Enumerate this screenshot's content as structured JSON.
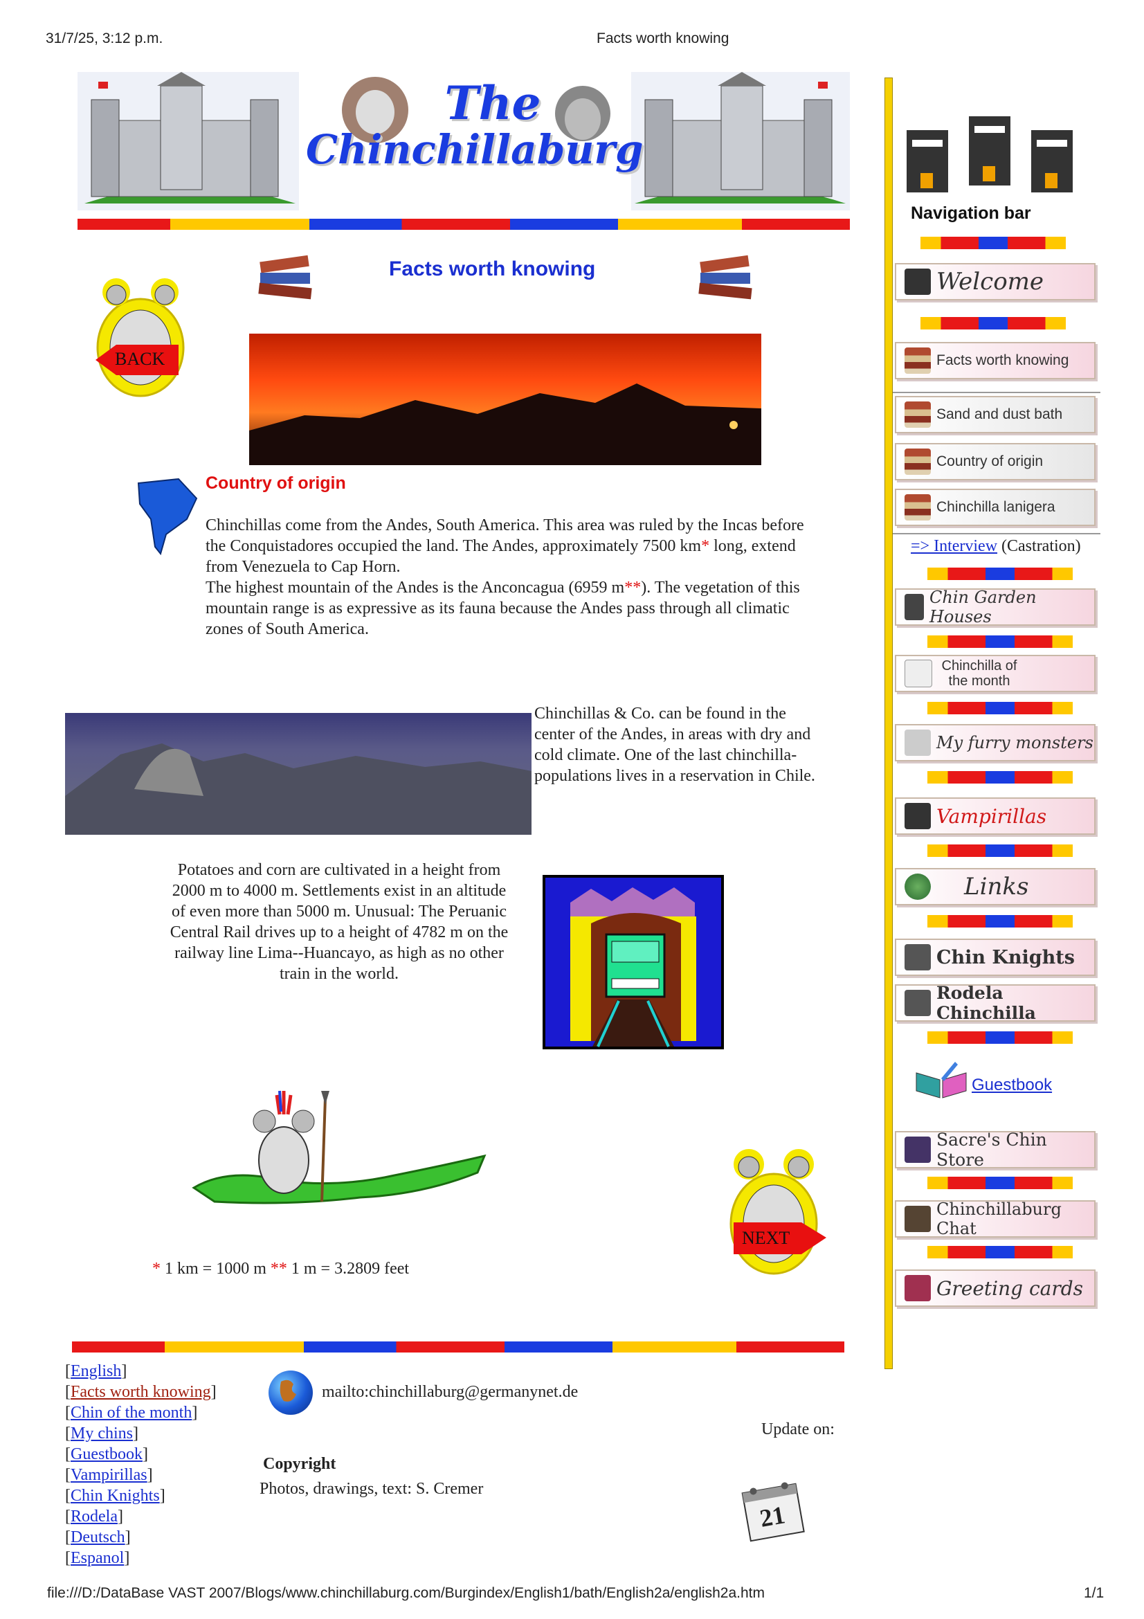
{
  "print_header": {
    "datetime": "31/7/25, 3:12 p.m.",
    "title": "Facts worth knowing"
  },
  "print_footer": {
    "path": "file:///D:/DataBase VAST 2007/Blogs/www.chinchillaburg.com/Burgindex/English1/bath/English2a/english2a.htm",
    "page": "1/1"
  },
  "logo": {
    "line1": "The",
    "line2": "Chinchillaburg"
  },
  "page_heading": "Facts worth knowing",
  "back_label": "BACK",
  "next_label": "NEXT",
  "section_title": "Country of origin",
  "para1": {
    "a": "Chinchillas come from the Andes, South America. This area was ruled by the Incas before the Conquistadores occupied the land. The Andes, approximately 7500 km",
    "star1": "*",
    "b": " long, extend from Venezuela to Cap Horn.",
    "c": "The highest mountain of the Andes is the Anconcagua (6959 m",
    "star2": "**",
    "d": "). The vegetation of this mountain range is as expressive as its fauna because the Andes pass through all climatic zones of South America."
  },
  "para2": "Chinchillas & Co. can be found in the center of the Andes, in areas with dry and cold climate. One of the last chinchilla-populations lives in a reservation in Chile.",
  "para3": "Potatoes and corn are cultivated in a height from 2000 m to 4000 m. Settlements exist in an altitude of even more than 5000 m. Unusual: The Peruanic Central Rail drives up to a height of 4782 m on the railway line Lima--Huancayo, as  high as no other train in the world.",
  "footnote": {
    "star1": "*",
    "text1": " 1 km = 1000 m  ",
    "star2": "**",
    "text2": " 1 m = 3.2809 feet"
  },
  "bottom_links": [
    "English",
    "Facts worth knowing",
    "Chin of the month",
    "My chins",
    "Guestbook",
    "Vampirillas",
    "Chin Knights",
    "Rodela",
    "Deutsch",
    "Espanol"
  ],
  "contact": {
    "mail": "mailto:chinchillaburg@germanynet.de",
    "update": "Update on:",
    "copyright_title": "Copyright",
    "copyright_text": "Photos, drawings, text: S. Cremer",
    "calendar_day": "21"
  },
  "nav": {
    "title": "Navigation bar",
    "welcome": "Welcome",
    "facts": "Facts worth knowing",
    "sand": "Sand and dust bath",
    "country": "Country of origin",
    "lanigera": "Chinchilla lanigera",
    "interview_link": "=> Interview",
    "interview_note": " (Castration)",
    "garden": "Chin Garden Houses",
    "month_line1": "Chinchilla of",
    "month_line2": "the month",
    "furry": "My furry monsters",
    "vamp": "Vampirillas",
    "links": "Links",
    "knights": "Chin Knights",
    "rodela": "Rodela Chinchilla",
    "guestbook": "Guestbook",
    "store": "Sacre's Chin Store",
    "chat": "Chinchillaburg Chat",
    "cards": "Greeting cards"
  },
  "colors": {
    "accent_blue": "#1a2fd0",
    "heading_red": "#e01010",
    "nav_yellow": "#f5d000"
  }
}
